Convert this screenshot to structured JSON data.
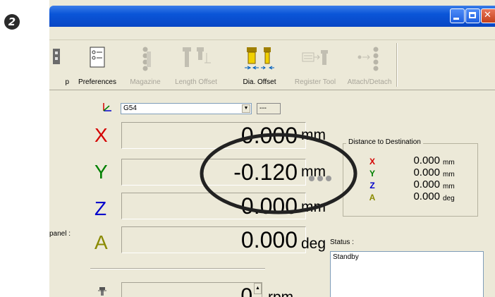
{
  "step_badge": "2",
  "toolbar": {
    "items": [
      {
        "label": "p",
        "enabled": true,
        "icon": "truncated-icon"
      },
      {
        "label": "Preferences",
        "enabled": true,
        "icon": "preferences-icon"
      },
      {
        "label": "Magazine",
        "enabled": false,
        "icon": "magazine-icon"
      },
      {
        "label": "Length Offset",
        "enabled": false,
        "icon": "length-offset-icon"
      },
      {
        "label": "Dia. Offset",
        "enabled": true,
        "icon": "dia-offset-icon"
      },
      {
        "label": "Register Tool",
        "enabled": false,
        "icon": "register-tool-icon"
      },
      {
        "label": "Attach/Detach",
        "enabled": false,
        "icon": "attach-detach-icon"
      }
    ]
  },
  "wcs": {
    "selected": "G54",
    "extra": "---"
  },
  "axes": [
    {
      "letter": "X",
      "value": "0.000",
      "unit": "mm",
      "color": "#d40000"
    },
    {
      "letter": "Y",
      "value": "-0.120",
      "unit": "mm",
      "color": "#008000"
    },
    {
      "letter": "Z",
      "value": "0.000",
      "unit": "mm",
      "color": "#0000cc"
    },
    {
      "letter": "A",
      "value": "0.000",
      "unit": "deg",
      "color": "#8a8a00"
    }
  ],
  "panel_label": "panel :",
  "distance": {
    "title": "Distance to Destination",
    "rows": [
      {
        "letter": "X",
        "value": "0.000",
        "unit": "mm",
        "color": "#d40000"
      },
      {
        "letter": "Y",
        "value": "0.000",
        "unit": "mm",
        "color": "#008000"
      },
      {
        "letter": "Z",
        "value": "0.000",
        "unit": "mm",
        "color": "#0000cc"
      },
      {
        "letter": "A",
        "value": "0.000",
        "unit": "deg",
        "color": "#8a8a00"
      }
    ]
  },
  "status": {
    "label": "Status :",
    "value": "Standby"
  },
  "spindle": {
    "value": "0",
    "unit": "rpm"
  }
}
